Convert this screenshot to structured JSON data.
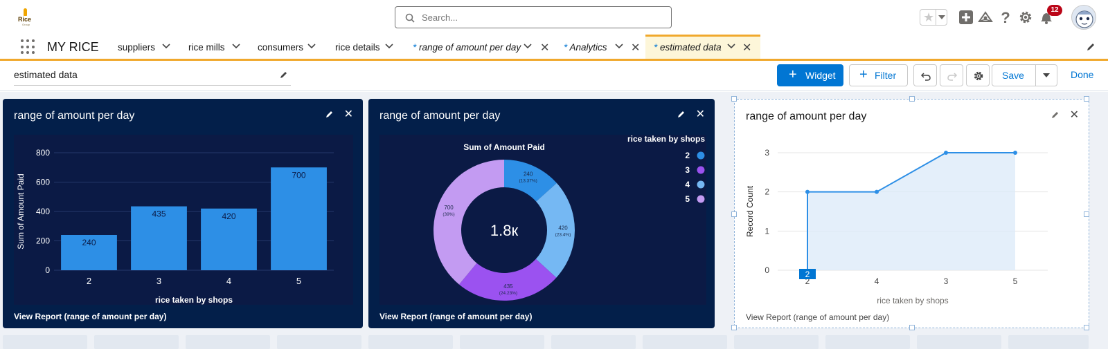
{
  "logo": {
    "text": "Rice",
    "sub": "Group"
  },
  "search": {
    "placeholder": "Search..."
  },
  "notifications": {
    "count": "12"
  },
  "app": {
    "name": "MY RICE"
  },
  "nav": {
    "tabs": [
      {
        "label": "suppliers"
      },
      {
        "label": "rice mills"
      },
      {
        "label": "consumers"
      },
      {
        "label": "rice details"
      },
      {
        "prefix": "*",
        "label": "range of amount per day"
      },
      {
        "prefix": "*",
        "label": "Analytics"
      },
      {
        "prefix": "*",
        "label": "estimated data"
      }
    ]
  },
  "toolbar": {
    "dashboard_title": "estimated data",
    "widget_label": "Widget",
    "filter_label": "Filter",
    "save_label": "Save",
    "done_label": "Done"
  },
  "widgets": [
    {
      "title": "range of amount per day",
      "link": "View Report (range of amount per day)"
    },
    {
      "title": "range of amount per day",
      "link": "View Report (range of amount per day)"
    },
    {
      "title": "range of amount per day",
      "link": "View Report (range of amount per day)"
    }
  ],
  "colors": {
    "brand": "#0176d3",
    "accent_tab": "#f0a82c",
    "widget_dark": "#031f4a",
    "bar": "#2d8fe6",
    "donut": [
      "#2d8fe6",
      "#9b52f0",
      "#75b8f3",
      "#c39bf2"
    ],
    "line": "#2d8fe6"
  },
  "chart_data": [
    {
      "type": "bar",
      "categories": [
        "2",
        "3",
        "4",
        "5"
      ],
      "values": [
        240,
        435,
        420,
        700
      ],
      "data_labels": [
        "240",
        "435",
        "420",
        "700"
      ],
      "xlabel": "rice taken by shops",
      "ylabel": "Sum of Amount Paid",
      "yticks": [
        "0",
        "200",
        "400",
        "600",
        "800"
      ],
      "ylim": [
        0,
        800
      ],
      "grid": true
    },
    {
      "type": "pie",
      "title": "Sum of Amount Paid",
      "center_label": "1.8к",
      "legend_title": "rice taken by shops",
      "legend_position": "top-right",
      "slices": [
        {
          "label": "2",
          "value": 240,
          "value_text": "240",
          "pct_text": "(13.37%)"
        },
        {
          "label": "4",
          "value": 420,
          "value_text": "420",
          "pct_text": "(23.4%)"
        },
        {
          "label": "3",
          "value": 435,
          "value_text": "435",
          "pct_text": "(24.23%)"
        },
        {
          "label": "5",
          "value": 700,
          "value_text": "700",
          "pct_text": "(39%)"
        }
      ],
      "legend": [
        {
          "label": "2",
          "color": "#2d8fe6"
        },
        {
          "label": "3",
          "color": "#9b52f0"
        },
        {
          "label": "4",
          "color": "#75b8f3"
        },
        {
          "label": "5",
          "color": "#c39bf2"
        }
      ]
    },
    {
      "type": "area",
      "categories": [
        "2",
        "4",
        "3",
        "5"
      ],
      "values": [
        2,
        2,
        3,
        3
      ],
      "highlight_label": "2",
      "xlabel": "rice taken by shops",
      "ylabel": "Record Count",
      "yticks": [
        "0",
        "1",
        "2",
        "3"
      ],
      "ylim": [
        0,
        3
      ],
      "grid": true
    }
  ]
}
